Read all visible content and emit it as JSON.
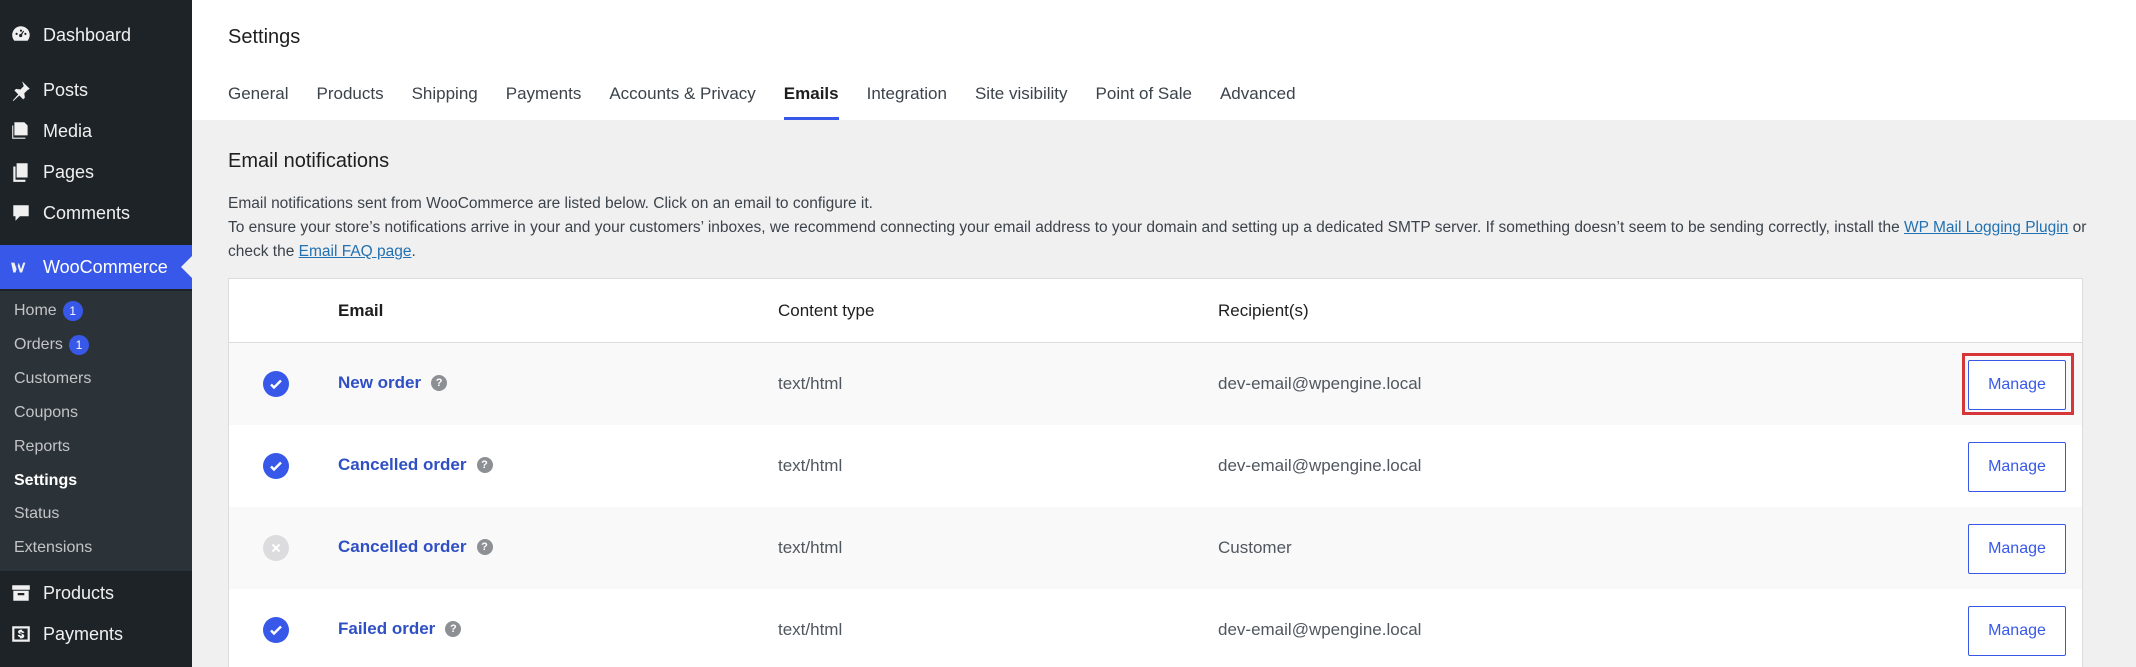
{
  "sidebar": {
    "menu": [
      {
        "label": "Dashboard",
        "icon": "dashboard-icon"
      },
      {
        "label": "Posts",
        "icon": "pin-icon"
      },
      {
        "label": "Media",
        "icon": "media-icon"
      },
      {
        "label": "Pages",
        "icon": "pages-icon"
      },
      {
        "label": "Comments",
        "icon": "comments-icon"
      }
    ],
    "woocommerce": {
      "label": "WooCommerce",
      "icon": "woocommerce-icon"
    },
    "submenu": [
      {
        "label": "Home",
        "badge": "1"
      },
      {
        "label": "Orders",
        "badge": "1"
      },
      {
        "label": "Customers"
      },
      {
        "label": "Coupons"
      },
      {
        "label": "Reports"
      },
      {
        "label": "Settings"
      },
      {
        "label": "Status"
      },
      {
        "label": "Extensions"
      }
    ],
    "bottom_menu": [
      {
        "label": "Products",
        "icon": "archive-icon"
      },
      {
        "label": "Payments",
        "icon": "dollar-icon"
      }
    ]
  },
  "header": {
    "title": "Settings",
    "tabs": [
      "General",
      "Products",
      "Shipping",
      "Payments",
      "Accounts & Privacy",
      "Emails",
      "Integration",
      "Site visibility",
      "Point of Sale",
      "Advanced"
    ],
    "active_tab": "Emails"
  },
  "content": {
    "section_title": "Email notifications",
    "desc_line1": "Email notifications sent from WooCommerce are listed below. Click on an email to configure it.",
    "desc_line2": "To ensure your store’s notifications arrive in your and your customers’ inboxes, we recommend connecting your email address to your domain and setting up a dedicated SMTP server. If something doesn’t seem to be sending correctly, install the",
    "desc_link1": "WP Mail Logging Plugin",
    "desc_or": "or",
    "desc_line3_prefix": "check the",
    "desc_link2": "Email FAQ page",
    "desc_line3_suffix": "."
  },
  "table": {
    "headers": {
      "email": "Email",
      "content_type": "Content type",
      "recipients": "Recipient(s)"
    },
    "rows": [
      {
        "enabled": true,
        "name": "New order",
        "content_type": "text/html",
        "recipient": "dev-email@wpengine.local",
        "action": "Manage"
      },
      {
        "enabled": true,
        "name": "Cancelled order",
        "content_type": "text/html",
        "recipient": "dev-email@wpengine.local",
        "action": "Manage"
      },
      {
        "enabled": false,
        "name": "Cancelled order",
        "content_type": "text/html",
        "recipient": "Customer",
        "action": "Manage"
      },
      {
        "enabled": true,
        "name": "Failed order",
        "content_type": "text/html",
        "recipient": "dev-email@wpengine.local",
        "action": "Manage"
      }
    ],
    "help_glyph": "?"
  },
  "colors": {
    "accent": "#3858e9",
    "sidebar": "#1d2327",
    "highlight": "#d63638"
  }
}
